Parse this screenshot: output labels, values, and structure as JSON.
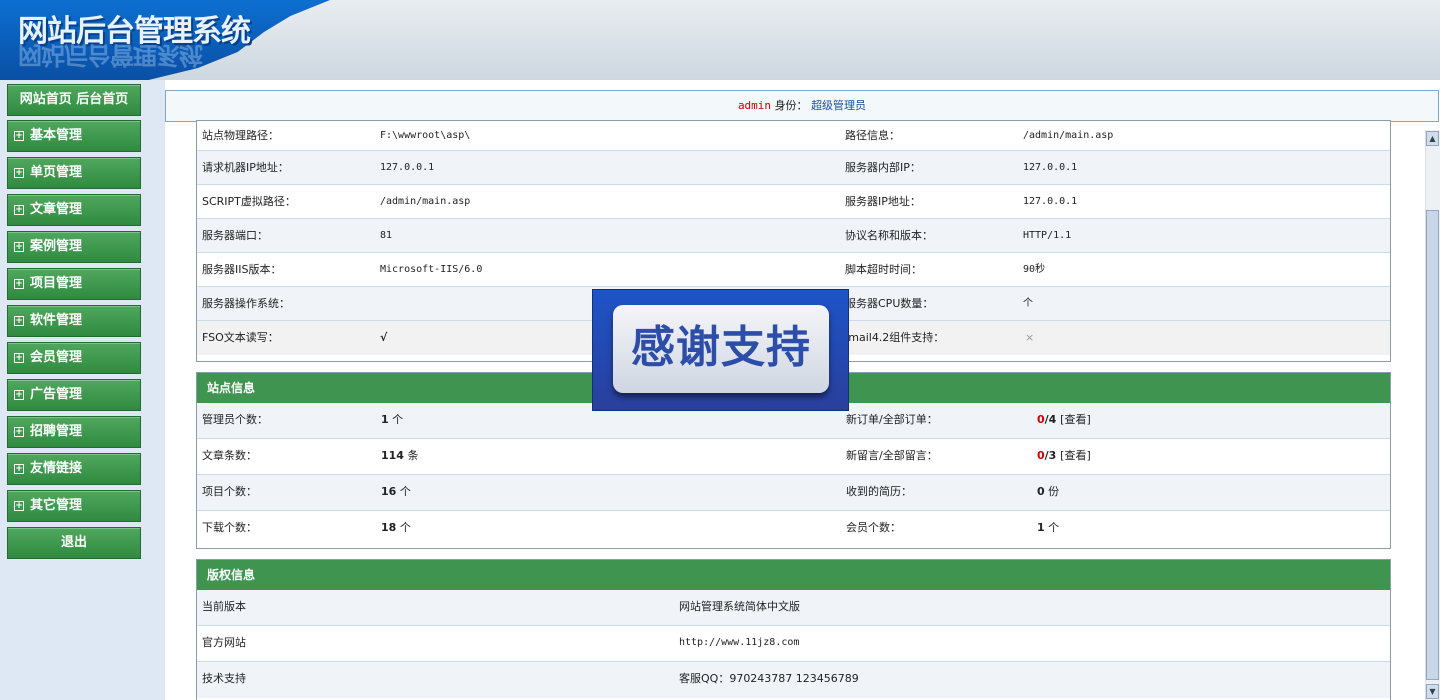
{
  "header": {
    "logo_text": "网站后台管理系统"
  },
  "sidebar": {
    "top_button": "网站首页 后台首页",
    "items": [
      "基本管理",
      "单页管理",
      "文章管理",
      "案例管理",
      "项目管理",
      "软件管理",
      "会员管理",
      "广告管理",
      "招聘管理",
      "友情链接",
      "其它管理"
    ],
    "plus_glyph": "⊞",
    "logout": "退出"
  },
  "admin_bar": {
    "username": "admin",
    "identity_label": "身份：",
    "role": "超级管理员"
  },
  "server_info": {
    "rows": [
      {
        "l1": "站点物理路径：",
        "v1": "F:\\wwwroot\\asp\\",
        "l2": "路径信息：",
        "v2": "/admin/main.asp"
      },
      {
        "l1": "请求机器IP地址：",
        "v1": "127.0.0.1",
        "l2": "服务器内部IP：",
        "v2": "127.0.0.1"
      },
      {
        "l1": "SCRIPT虚拟路径：",
        "v1": "/admin/main.asp",
        "l2": "服务器IP地址：",
        "v2": "127.0.0.1"
      },
      {
        "l1": "服务器端口：",
        "v1": "81",
        "l2": "协议名称和版本：",
        "v2": "HTTP/1.1"
      },
      {
        "l1": "服务器IIS版本：",
        "v1": "Microsoft-IIS/6.0",
        "l2": "脚本超时时间：",
        "v2": "90秒"
      },
      {
        "l1": "服务器操作系统：",
        "v1": "",
        "l2": "服务器CPU数量：",
        "v2": "个"
      },
      {
        "l1": "FSO文本读写：",
        "v1": "√",
        "l2": "Jmail4.2组件支持：",
        "v2": "×"
      }
    ]
  },
  "site_info": {
    "title": "站点信息",
    "rows": [
      {
        "l1": "管理员个数：",
        "n1": "1",
        "u1": "个",
        "l2": "新订单/全部订单：",
        "red2": "0",
        "rest2": "/4",
        "link2": "[查看]"
      },
      {
        "l1": "文章条数：",
        "n1": "114",
        "u1": "条",
        "l2": "新留言/全部留言：",
        "red2": "0",
        "rest2": "/3",
        "link2": "[查看]"
      },
      {
        "l1": "项目个数：",
        "n1": "16",
        "u1": "个",
        "l2": "收到的简历：",
        "red2": "",
        "rest2": "0",
        "link2": "份"
      },
      {
        "l1": "下载个数：",
        "n1": "18",
        "u1": "个",
        "l2": "会员个数：",
        "red2": "",
        "rest2": "1",
        "link2": "个"
      }
    ]
  },
  "copyright": {
    "title": "版权信息",
    "rows": [
      {
        "label": "当前版本",
        "value": "网站管理系统简体中文版"
      },
      {
        "label": "官方网站",
        "value": "http://www.11jz8.com"
      },
      {
        "label": "技术支持",
        "value": "客服QQ：970243787 123456789"
      }
    ]
  },
  "overlay": {
    "text": "感谢支持"
  },
  "scrollbar": {
    "up": "▲",
    "down": "▼"
  }
}
